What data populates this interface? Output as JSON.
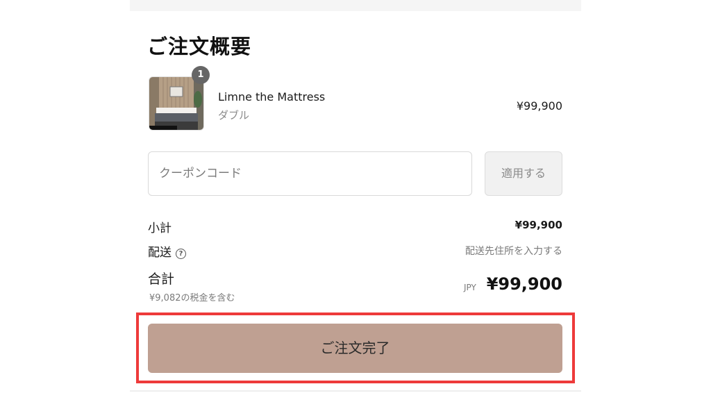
{
  "summary": {
    "title": "ご注文概要"
  },
  "product": {
    "quantity_badge": "1",
    "name": "Limne the Mattress",
    "variant": "ダブル",
    "price": "¥99,900",
    "image": "mattress-product-photo"
  },
  "coupon": {
    "placeholder": "クーポンコード",
    "value": "",
    "apply_label": "適用する"
  },
  "totals": {
    "subtotal_label": "小計",
    "subtotal_value": "¥99,900",
    "shipping_label": "配送",
    "shipping_value": "配送先住所を入力する",
    "shipping_info_icon": "?",
    "total_label": "合計",
    "tax_note": "¥9,082の税金を含む",
    "currency": "JPY",
    "total_value": "¥99,900"
  },
  "checkout": {
    "complete_label": "ご注文完了"
  },
  "colors": {
    "button_bg": "#bfa092",
    "highlight": "#ee3a3a"
  }
}
